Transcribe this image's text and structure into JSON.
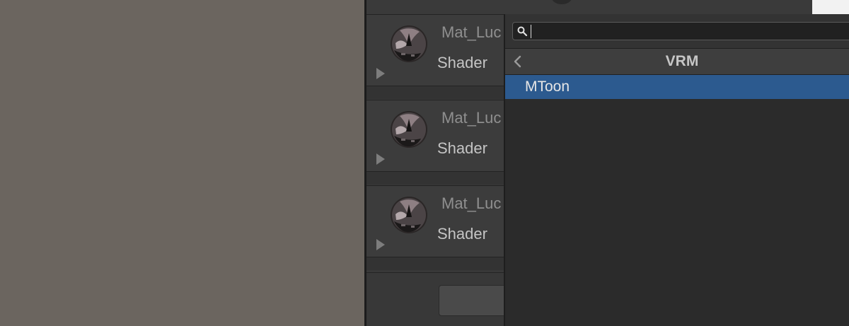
{
  "materials": [
    {
      "name": "Mat_Luc",
      "shader_label": "Shader"
    },
    {
      "name": "Mat_Luc",
      "shader_label": "Shader"
    },
    {
      "name": "Mat_Luc",
      "shader_label": "Shader"
    }
  ],
  "shader_popup": {
    "search": {
      "value": "",
      "placeholder": ""
    },
    "header_title": "VRM",
    "items": [
      {
        "label": "MToon",
        "selected": true
      }
    ]
  },
  "icons": {
    "search": "search-icon",
    "back": "chevron-left-icon",
    "foldout": "triangle-right-icon",
    "material_preview": "material-sphere-icon"
  },
  "colors": {
    "selection": "#2c5a8f",
    "scene_background": "#6b655f",
    "panel_background": "#383838",
    "popup_background": "#2b2b2b"
  }
}
